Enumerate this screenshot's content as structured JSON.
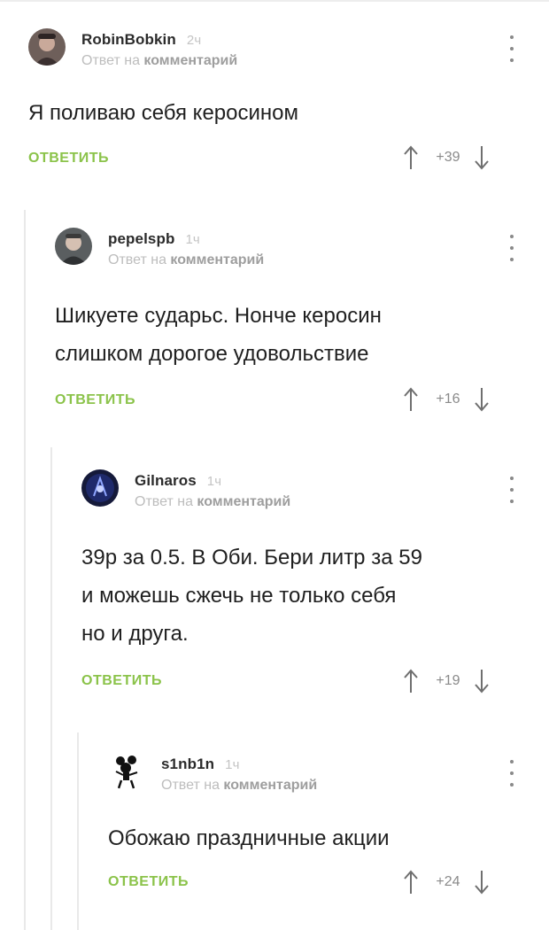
{
  "reply_to_prefix": "Ответ на",
  "reply_to_target": "комментарий",
  "comments": [
    {
      "username": "RobinBobkin",
      "time": "2ч",
      "text_lines": [
        "Я поливаю себя керосином"
      ],
      "reply_label": "ОТВЕТИТЬ",
      "rating": "+39"
    },
    {
      "username": "pepelspb",
      "time": "1ч",
      "text_lines": [
        "Шикуете сударьс. Нонче керосин",
        "слишком дорогое удовольствие"
      ],
      "reply_label": "ОТВЕТИТЬ",
      "rating": "+16"
    },
    {
      "username": "Gilnaros",
      "time": "1ч",
      "text_lines": [
        "39р за 0.5. В Оби. Бери литр за 59",
        "и можешь сжечь не только себя",
        "но и друга."
      ],
      "reply_label": "ОТВЕТИТЬ",
      "rating": "+19"
    },
    {
      "username": "s1nb1n",
      "time": "1ч",
      "text_lines": [
        "Обожаю праздничные акции"
      ],
      "reply_label": "ОТВЕТИТЬ",
      "rating": "+24"
    }
  ],
  "icons": {
    "more": "more-vertical-icon",
    "upvote": "arrow-up-icon",
    "downvote": "arrow-down-icon"
  },
  "colors": {
    "accent": "#8bc34a",
    "muted": "#bdbdbd",
    "text": "#1f1f1f"
  }
}
